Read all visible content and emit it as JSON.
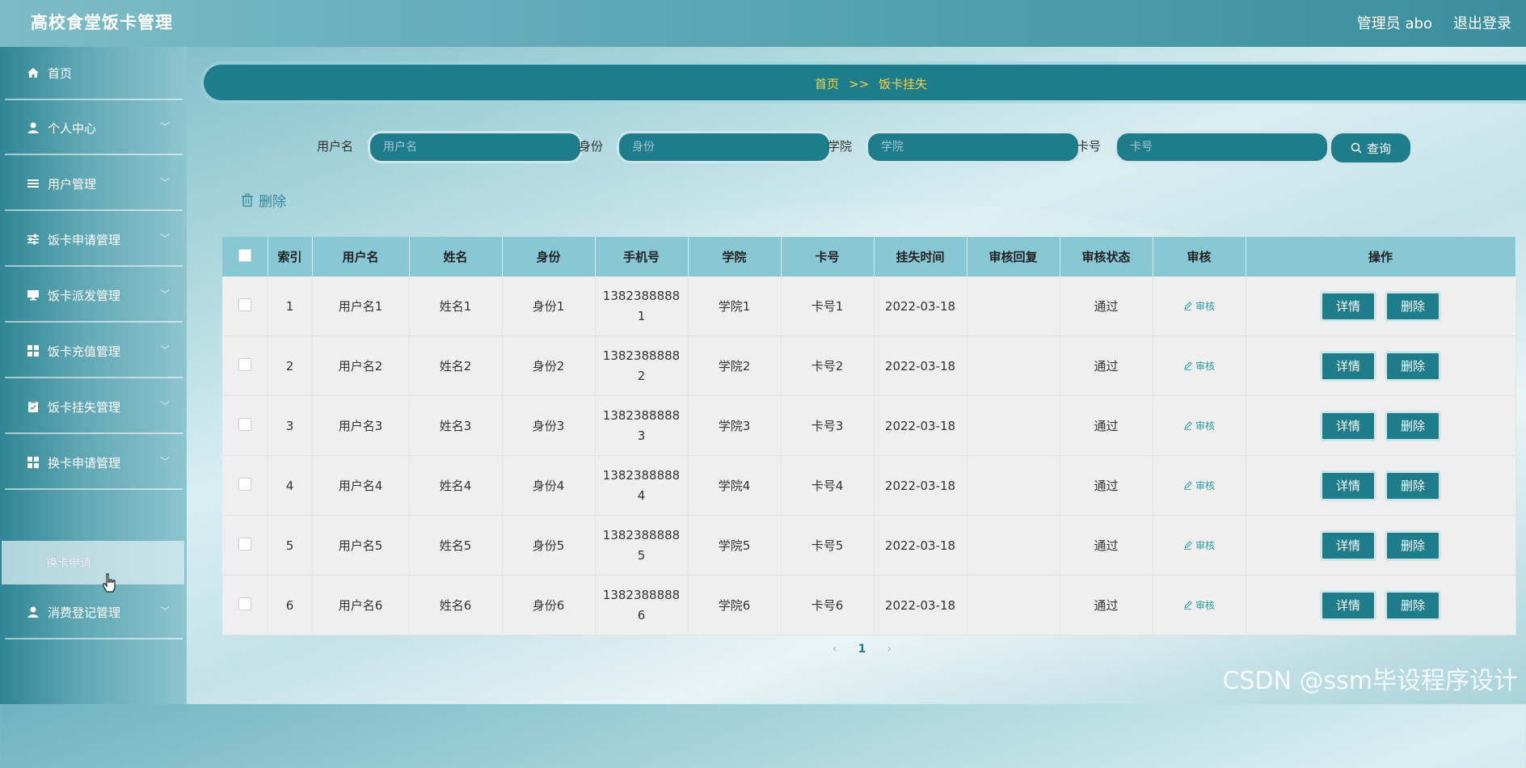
{
  "header": {
    "title": "高校食堂饭卡管理",
    "admin_label": "管理员 abo",
    "logout_label": "退出登录"
  },
  "sidebar": {
    "items": [
      {
        "label": "首页",
        "icon": "home-icon",
        "has_chevron": false
      },
      {
        "label": "个人中心",
        "icon": "user-icon",
        "has_chevron": true
      },
      {
        "label": "用户管理",
        "icon": "list-icon",
        "has_chevron": true
      },
      {
        "label": "饭卡申请管理",
        "icon": "sliders-icon",
        "has_chevron": true
      },
      {
        "label": "饭卡派发管理",
        "icon": "monitor-icon",
        "has_chevron": true
      },
      {
        "label": "饭卡充值管理",
        "icon": "grid-icon",
        "has_chevron": true
      },
      {
        "label": "饭卡挂失管理",
        "icon": "clipboard-icon",
        "has_chevron": true
      },
      {
        "label": "换卡申请管理",
        "icon": "grid-icon",
        "has_chevron": true
      },
      {
        "label": "消费登记管理",
        "icon": "user-icon",
        "has_chevron": true
      }
    ],
    "submenu": {
      "label": "换卡申请"
    }
  },
  "breadcrumb": {
    "home": "首页",
    "separator": ">>",
    "current": "饭卡挂失"
  },
  "search": {
    "fields": [
      {
        "label": "用户名",
        "placeholder": "用户名"
      },
      {
        "label": "身份",
        "placeholder": "身份"
      },
      {
        "label": "学院",
        "placeholder": "学院"
      },
      {
        "label": "卡号",
        "placeholder": "卡号"
      }
    ],
    "query_label": "查询"
  },
  "toolbar": {
    "delete_label": "删除"
  },
  "table": {
    "columns": [
      "索引",
      "用户名",
      "姓名",
      "身份",
      "手机号",
      "学院",
      "卡号",
      "挂失时间",
      "审核回复",
      "审核状态",
      "审核",
      "操作"
    ],
    "audit_label": "审核",
    "detail_label": "详情",
    "delete_label": "删除",
    "rows": [
      {
        "index": "1",
        "username": "用户名1",
        "name": "姓名1",
        "identity": "身份1",
        "phone_a": "1382388888",
        "phone_b": "1",
        "college": "学院1",
        "card": "卡号1",
        "date": "2022-03-18",
        "reply": "",
        "status": "通过"
      },
      {
        "index": "2",
        "username": "用户名2",
        "name": "姓名2",
        "identity": "身份2",
        "phone_a": "1382388888",
        "phone_b": "2",
        "college": "学院2",
        "card": "卡号2",
        "date": "2022-03-18",
        "reply": "",
        "status": "通过"
      },
      {
        "index": "3",
        "username": "用户名3",
        "name": "姓名3",
        "identity": "身份3",
        "phone_a": "1382388888",
        "phone_b": "3",
        "college": "学院3",
        "card": "卡号3",
        "date": "2022-03-18",
        "reply": "",
        "status": "通过"
      },
      {
        "index": "4",
        "username": "用户名4",
        "name": "姓名4",
        "identity": "身份4",
        "phone_a": "1382388888",
        "phone_b": "4",
        "college": "学院4",
        "card": "卡号4",
        "date": "2022-03-18",
        "reply": "",
        "status": "通过"
      },
      {
        "index": "5",
        "username": "用户名5",
        "name": "姓名5",
        "identity": "身份5",
        "phone_a": "1382388888",
        "phone_b": "5",
        "college": "学院5",
        "card": "卡号5",
        "date": "2022-03-18",
        "reply": "",
        "status": "通过"
      },
      {
        "index": "6",
        "username": "用户名6",
        "name": "姓名6",
        "identity": "身份6",
        "phone_a": "1382388888",
        "phone_b": "6",
        "college": "学院6",
        "card": "卡号6",
        "date": "2022-03-18",
        "reply": "",
        "status": "通过"
      }
    ]
  },
  "pagination": {
    "prev": "‹",
    "current": "1",
    "next": "›"
  },
  "watermark": "CSDN @ssm毕设程序设计",
  "colors": {
    "primary": "#1f7c8b",
    "header_cell": "#88c8d4",
    "breadcrumb_text": "#f6d34a",
    "audit_link": "#2a9ea9"
  }
}
